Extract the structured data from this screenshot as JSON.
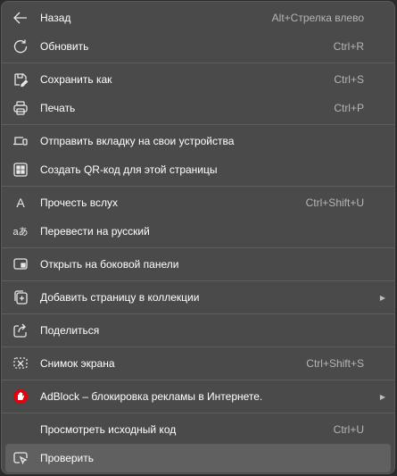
{
  "menu": {
    "items": [
      {
        "label": "Назад",
        "shortcut": "Alt+Стрелка влево",
        "icon": "arrow-left-icon"
      },
      {
        "label": "Обновить",
        "shortcut": "Ctrl+R",
        "icon": "refresh-icon"
      },
      {
        "label": "Сохранить как",
        "shortcut": "Ctrl+S",
        "icon": "save-as-icon"
      },
      {
        "label": "Печать",
        "shortcut": "Ctrl+P",
        "icon": "print-icon"
      },
      {
        "label": "Отправить вкладку на свои устройства",
        "icon": "devices-icon"
      },
      {
        "label": "Создать QR-код для этой страницы",
        "icon": "qr-code-icon"
      },
      {
        "label": "Прочесть вслух",
        "shortcut": "Ctrl+Shift+U",
        "icon": "read-aloud-icon"
      },
      {
        "label": "Перевести на русский",
        "icon": "translate-icon"
      },
      {
        "label": "Открыть на боковой панели",
        "icon": "sidebar-icon"
      },
      {
        "label": "Добавить страницу в коллекции",
        "icon": "collections-icon",
        "submenu": true
      },
      {
        "label": "Поделиться",
        "icon": "share-icon"
      },
      {
        "label": "Снимок экрана",
        "shortcut": "Ctrl+Shift+S",
        "icon": "screenshot-icon"
      },
      {
        "label": "AdBlock – блокировка рекламы в Интернете.",
        "icon": "adblock-icon",
        "submenu": true
      },
      {
        "label": "Просмотреть исходный код",
        "shortcut": "Ctrl+U"
      },
      {
        "label": "Проверить",
        "icon": "inspect-icon",
        "hovered": true
      }
    ],
    "read_aloud_glyph": "A",
    "translate_glyph": "aあ",
    "submenu_arrow": "▶",
    "adblock_color": "#e3000f"
  }
}
